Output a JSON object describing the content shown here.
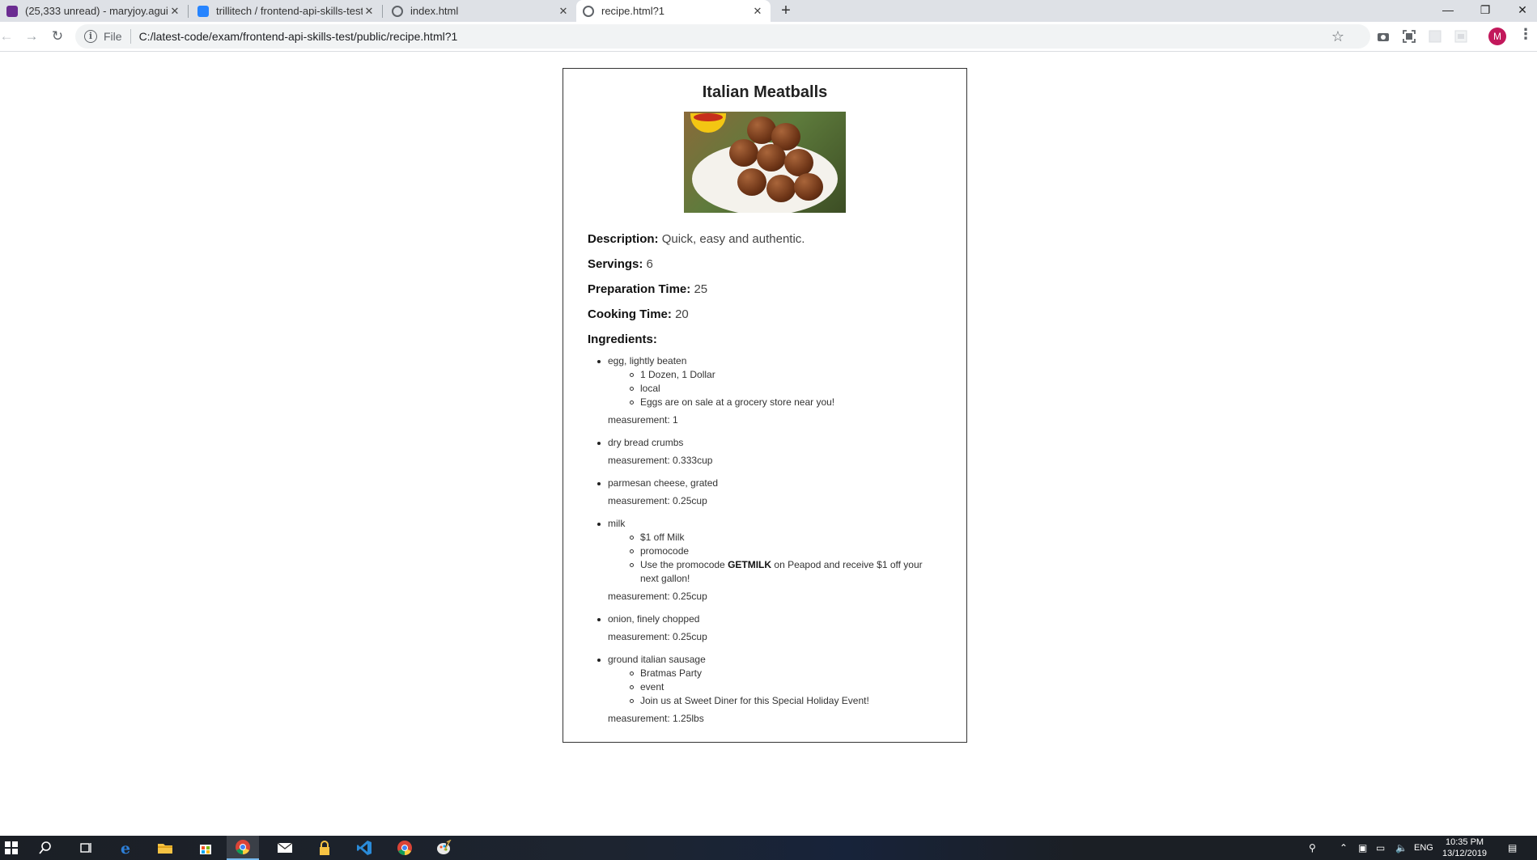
{
  "browser": {
    "tabs": [
      {
        "title": "(25,333 unread) - maryjoy.aguisa",
        "favicon": "mail-icon",
        "color": "#6b2c91",
        "active": false
      },
      {
        "title": "trillitech / frontend-api-skills-test",
        "favicon": "bitbucket-icon",
        "color": "#2684ff",
        "active": false
      },
      {
        "title": "index.html",
        "favicon": "globe-icon",
        "color": "#5f6368",
        "active": false
      },
      {
        "title": "recipe.html?1",
        "favicon": "globe-icon",
        "color": "#5f6368",
        "active": true
      }
    ],
    "address": {
      "scheme_label": "File",
      "url": "C:/latest-code/exam/frontend-api-skills-test/public/recipe.html?1"
    },
    "profile_initial": "M"
  },
  "recipe": {
    "title": "Italian Meatballs",
    "image_alt": "meatballs-photo",
    "description_label": "Description:",
    "description": "Quick, easy and authentic.",
    "servings_label": "Servings:",
    "servings": "6",
    "prep_label": "Preparation Time:",
    "prep_time": "25",
    "cook_label": "Cooking Time:",
    "cook_time": "20",
    "ingredients_label": "Ingredients:",
    "ingredients": [
      {
        "name": "egg, lightly beaten",
        "promos": [
          "1 Dozen, 1 Dollar",
          "local",
          "Eggs are on sale at a grocery store near you!"
        ],
        "measurement": "measurement: 1"
      },
      {
        "name": "dry bread crumbs",
        "promos": [],
        "measurement": "measurement: 0.333cup"
      },
      {
        "name": "parmesan cheese, grated",
        "promos": [],
        "measurement": "measurement: 0.25cup"
      },
      {
        "name": "milk",
        "promos": [
          "$1 off Milk",
          "promocode"
        ],
        "promo_text": {
          "before": "Use the promocode ",
          "code": "GETMILK",
          "after": " on Peapod and receive $1 off your next gallon!"
        },
        "measurement": "measurement: 0.25cup"
      },
      {
        "name": "onion, finely chopped",
        "promos": [],
        "measurement": "measurement: 0.25cup"
      },
      {
        "name": "ground italian sausage",
        "promos": [
          "Bratmas Party",
          "event",
          "Join us at Sweet Diner for this Special Holiday Event!"
        ],
        "measurement": "measurement: 1.25lbs"
      }
    ]
  },
  "taskbar": {
    "time": "10:35 PM",
    "date": "13/12/2019",
    "language": "ENG"
  }
}
